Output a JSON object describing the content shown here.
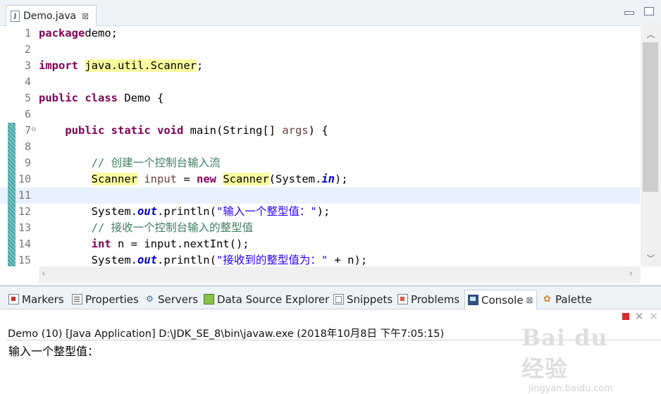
{
  "editor": {
    "tab": {
      "icon": "java-file-icon",
      "label": "Demo.java",
      "close": "⊠"
    },
    "lines": [
      {
        "n": "1",
        "tokens": [
          [
            "kw",
            "package"
          ],
          [
            "",
            "demo;"
          ]
        ]
      },
      {
        "n": "2",
        "tokens": []
      },
      {
        "n": "3",
        "tokens": [
          [
            "kw",
            "import"
          ],
          [
            "",
            ""
          ],
          [
            "hl",
            "java.util.Scanner"
          ],
          [
            "",
            ";"
          ]
        ]
      },
      {
        "n": "4",
        "tokens": []
      },
      {
        "n": "5",
        "tokens": [
          [
            "kw",
            "public"
          ],
          [
            "",
            " "
          ],
          [
            "kw",
            "class"
          ],
          [
            "",
            " Demo {"
          ]
        ]
      },
      {
        "n": "6",
        "tokens": []
      },
      {
        "n": "7",
        "fold": "⊖",
        "tokens": [
          [
            "",
            "    "
          ],
          [
            "kw",
            "public"
          ],
          [
            "",
            " "
          ],
          [
            "kw",
            "static"
          ],
          [
            "",
            " "
          ],
          [
            "kw",
            "void"
          ],
          [
            "",
            " main(String[] "
          ],
          [
            "prm",
            "args"
          ],
          [
            "",
            ") {"
          ]
        ]
      },
      {
        "n": "8",
        "tokens": []
      },
      {
        "n": "9",
        "tokens": [
          [
            "",
            "        "
          ],
          [
            "cm",
            "// 创建一个控制台输入流"
          ]
        ]
      },
      {
        "n": "10",
        "tokens": [
          [
            "",
            "        "
          ],
          [
            "hl",
            "Scanner"
          ],
          [
            "",
            " "
          ],
          [
            "prm",
            "input"
          ],
          [
            "",
            " = "
          ],
          [
            "kw",
            "new"
          ],
          [
            "",
            " "
          ],
          [
            "hl",
            "Scanner"
          ],
          [
            "",
            "(System."
          ],
          [
            "fld",
            "in"
          ],
          [
            "",
            ");"
          ]
        ]
      },
      {
        "n": "11",
        "current": true,
        "tokens": []
      },
      {
        "n": "12",
        "tokens": [
          [
            "",
            "        System."
          ],
          [
            "fld",
            "out"
          ],
          [
            "",
            ".println("
          ],
          [
            "st",
            "\"输入一个整型值：\""
          ],
          [
            "",
            ");"
          ]
        ]
      },
      {
        "n": "13",
        "tokens": [
          [
            "",
            "        "
          ],
          [
            "cm",
            "// 接收一个控制台输入的整型值"
          ]
        ]
      },
      {
        "n": "14",
        "tokens": [
          [
            "",
            "        "
          ],
          [
            "kw",
            "int"
          ],
          [
            "",
            " n = input.nextInt();"
          ]
        ]
      },
      {
        "n": "15",
        "tokens": [
          [
            "",
            "        System."
          ],
          [
            "fld",
            "out"
          ],
          [
            "",
            ".println("
          ],
          [
            "st",
            "\"接收到的整型值为：\""
          ],
          [
            "",
            " + n);"
          ]
        ]
      }
    ]
  },
  "panel": {
    "tabs": [
      {
        "icon": "markers",
        "label": "Markers"
      },
      {
        "icon": "properties",
        "label": "Properties"
      },
      {
        "icon": "servers",
        "label": "Servers"
      },
      {
        "icon": "dse",
        "label": "Data Source Explorer"
      },
      {
        "icon": "snippets",
        "label": "Snippets"
      },
      {
        "icon": "problems",
        "label": "Problems"
      },
      {
        "icon": "console",
        "label": "Console",
        "active": true
      },
      {
        "icon": "palette",
        "label": "Palette"
      }
    ],
    "console_header": "Demo (10) [Java Application] D:\\JDK_SE_8\\bin\\javaw.exe (2018年10月8日 下午7:05:15)",
    "console_output": "输入一个整型值："
  },
  "watermark": {
    "brand": "Bai du 经验",
    "url": "jingyan.baidu.com"
  }
}
